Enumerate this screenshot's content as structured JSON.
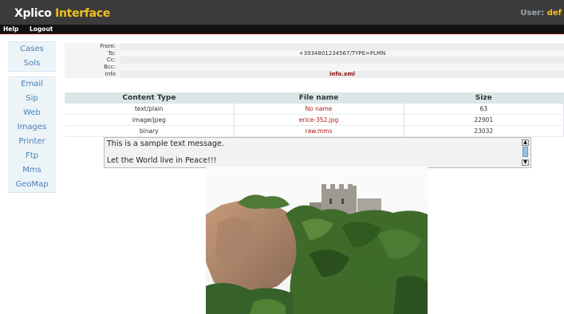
{
  "header": {
    "brand_part1": "Xplico ",
    "brand_part2": "Interface",
    "user_label": "User: ",
    "user_name": "def"
  },
  "menu": {
    "help": "Help",
    "logout": "Logout"
  },
  "sidebar": {
    "group1": [
      {
        "label": "Cases"
      },
      {
        "label": "Sols"
      }
    ],
    "group2": [
      {
        "label": "Email"
      },
      {
        "label": "Sip"
      },
      {
        "label": "Web"
      },
      {
        "label": "Images"
      },
      {
        "label": "Printer"
      },
      {
        "label": "Ftp"
      },
      {
        "label": "Mms"
      },
      {
        "label": "GeoMap"
      }
    ]
  },
  "message_header": {
    "from_label": "From:",
    "from_value": "",
    "to_label": "To:",
    "to_value": "+3934801234567/TYPE=PLMN",
    "cc_label": "Cc:",
    "cc_value": "",
    "bcc_label": "Bcc:",
    "bcc_value": "",
    "info_label": "Info",
    "info_value": "info.xml"
  },
  "contents": {
    "columns": [
      "Content Type",
      "File name",
      "Size"
    ],
    "rows": [
      {
        "type": "text/plain",
        "file": "No name",
        "size": "63"
      },
      {
        "type": "image/jpeg",
        "file": "erice-352.jpg",
        "size": "22901"
      },
      {
        "type": "binary",
        "file": "raw.mms",
        "size": "23032"
      }
    ]
  },
  "message_text": "This is a sample text message.\n\nLet the World live in Peace!!!",
  "colors": {
    "topbar": "#3b3b3b",
    "brand_accent": "#f0c020",
    "sidebar_link": "#4a7fb5",
    "table_header": "#dbe6e8",
    "filename_red": "#b01a1a"
  }
}
